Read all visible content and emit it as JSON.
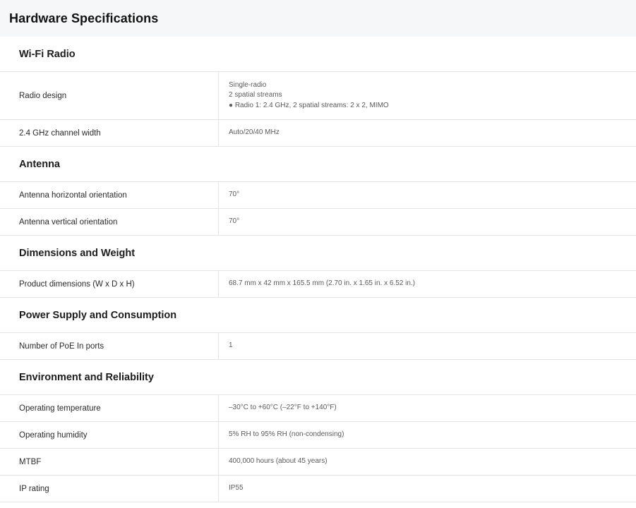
{
  "header": {
    "title": "Hardware Specifications"
  },
  "sections": [
    {
      "title": "Wi-Fi Radio",
      "rows": [
        {
          "label": "Radio design",
          "values": [
            "Single-radio",
            "2 spatial streams",
            "● Radio 1: 2.4 GHz, 2 spatial streams: 2 x 2, MIMO"
          ]
        },
        {
          "label": "2.4 GHz channel width",
          "values": [
            "Auto/20/40 MHz"
          ]
        }
      ]
    },
    {
      "title": "Antenna",
      "rows": [
        {
          "label": "Antenna horizontal orientation",
          "values": [
            "70°"
          ]
        },
        {
          "label": "Antenna vertical orientation",
          "values": [
            "70°"
          ]
        }
      ]
    },
    {
      "title": "Dimensions and Weight",
      "rows": [
        {
          "label": "Product dimensions (W x D x H)",
          "values": [
            "68.7 mm x 42 mm x 165.5 mm (2.70 in. x 1.65 in. x 6.52 in.)"
          ]
        }
      ]
    },
    {
      "title": "Power Supply and Consumption",
      "rows": [
        {
          "label": "Number of PoE In ports",
          "values": [
            "1"
          ]
        }
      ]
    },
    {
      "title": "Environment and Reliability",
      "rows": [
        {
          "label": "Operating temperature",
          "values": [
            "–30°C to +60°C (–22°F to +140°F)"
          ]
        },
        {
          "label": "Operating humidity",
          "values": [
            "5% RH to 95% RH (non-condensing)"
          ]
        },
        {
          "label": "MTBF",
          "values": [
            "400,000 hours (about 45 years)"
          ]
        },
        {
          "label": "IP rating",
          "values": [
            "IP55"
          ]
        }
      ]
    }
  ]
}
